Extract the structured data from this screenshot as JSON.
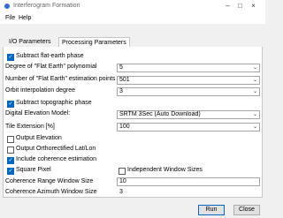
{
  "window": {
    "title": "Interferogram Formation"
  },
  "menu": [
    "File",
    "Help"
  ],
  "tabs": [
    {
      "label": "I/O Parameters"
    },
    {
      "label": "Processing Parameters"
    }
  ],
  "form": {
    "subtract_flat_earth": {
      "label": "Subtract flat-earth phase",
      "checked": true
    },
    "degree_flat_earth": {
      "label": "Degree of \"Flat Earth\" polynomial",
      "value": "5"
    },
    "num_flat_earth_points": {
      "label": "Number of \"Flat Earth\" estimation points",
      "value": "501"
    },
    "orbit_degree": {
      "label": "Orbit interpolation degree",
      "value": "3"
    },
    "subtract_topo": {
      "label": "Subtract topographic phase",
      "checked": true
    },
    "dem": {
      "label": "Digital Elevation Model:",
      "value": "SRTM 3Sec (Auto Download)"
    },
    "tile_extension": {
      "label": "Tile Extension [%]",
      "value": "100"
    },
    "output_elevation": {
      "label": "Output Elevation",
      "checked": false
    },
    "output_ortho": {
      "label": "Output Orthorectified Lat/Lon",
      "checked": false
    },
    "include_coherence": {
      "label": "Include coherence estimation",
      "checked": true
    },
    "square_pixel": {
      "label": "Square Pixel",
      "checked": true
    },
    "independent_window": {
      "label": "Independent Window Sizes",
      "checked": false
    },
    "coh_range": {
      "label": "Coherence Range Window Size",
      "value": "10"
    },
    "coh_azimuth": {
      "label": "Coherence Azimuth Window Size",
      "value": "3"
    }
  },
  "buttons": {
    "run": "Run",
    "close": "Close"
  },
  "colors": {
    "accent": "#0067c0",
    "icon": "#2f6fd0"
  },
  "icons": {
    "app": "app-icon",
    "check": "✓",
    "dropdown": "chevron-down-icon"
  }
}
